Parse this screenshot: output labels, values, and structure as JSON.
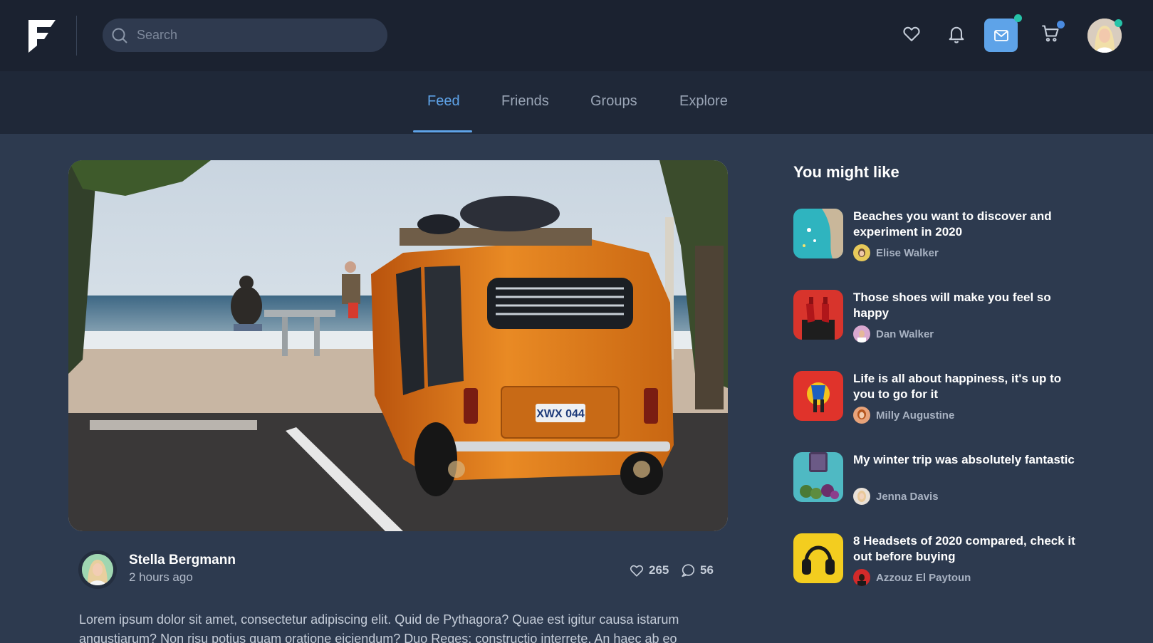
{
  "search": {
    "placeholder": "Search"
  },
  "header": {
    "icons": [
      "heart-icon",
      "bell-icon",
      "mail-icon",
      "cart-icon"
    ],
    "accent": "#5ea3e8",
    "badges": {
      "mail": "#26c3a8",
      "cart": "#4a8be0",
      "avatar": "#26c3a8"
    }
  },
  "tabs": [
    {
      "label": "Feed",
      "active": true
    },
    {
      "label": "Friends",
      "active": false
    },
    {
      "label": "Groups",
      "active": false
    },
    {
      "label": "Explore",
      "active": false
    }
  ],
  "post": {
    "author": "Stella Bergmann",
    "time": "2 hours ago",
    "likes": "265",
    "comments": "56",
    "text": "Lorem ipsum dolor sit amet, consectetur adipiscing elit. Quid de Pythagora? Quae est igitur causa istarum angustiarum? Non risu potius quam oratione eiciendum? Duo Reges: constructio interrete. An haec ab eo"
  },
  "sidebar": {
    "title": "You might like",
    "items": [
      {
        "title": "Beaches you want to discover and experiment in 2020",
        "author": "Elise Walker"
      },
      {
        "title": "Those shoes will make you feel so happy",
        "author": "Dan Walker"
      },
      {
        "title": "Life is all about happiness, it's up to you to go for it",
        "author": "Milly Augustine"
      },
      {
        "title": "My winter trip was absolutely fantastic",
        "author": "Jenna Davis"
      },
      {
        "title": "8 Headsets of 2020 compared, check it out before buying",
        "author": "Azzouz El Paytoun"
      }
    ]
  }
}
